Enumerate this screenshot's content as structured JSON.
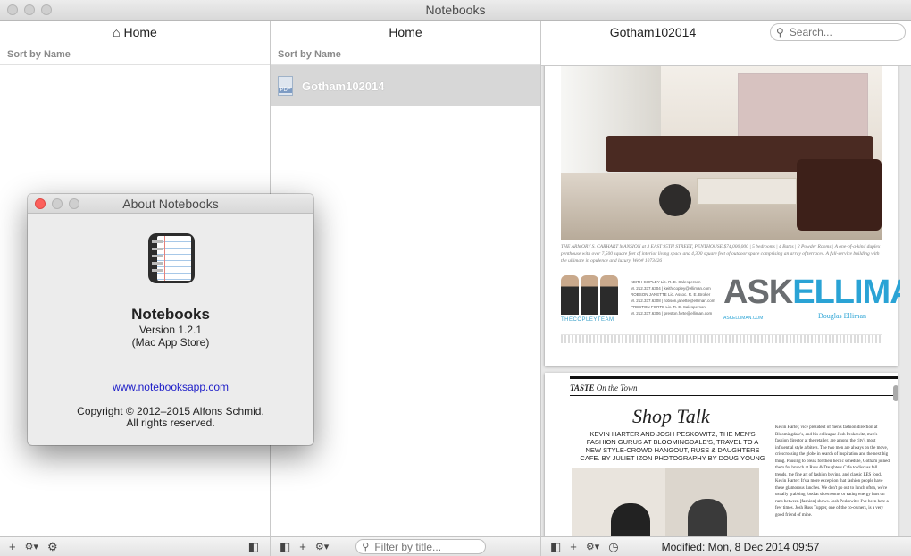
{
  "window": {
    "title": "Notebooks"
  },
  "pane1": {
    "header": "⌂ Home",
    "sort_label": "Sort by Name"
  },
  "pane2": {
    "header": "Home",
    "sort_label": "Sort by Name",
    "items": [
      {
        "name": "Gotham102014",
        "icon": "pdf-icon",
        "icon_text": "PDF"
      }
    ]
  },
  "pane3": {
    "header": "Gotham102014",
    "search": {
      "placeholder": "Search...",
      "icon": "search-icon"
    },
    "document": {
      "page1": {
        "caption": "THE ARMORY S. CARHART MANSION at 3 EAST 95TH STREET, PENTHOUSE  $74,000,000 | 5 bedrooms | 4 Baths | 2 Powder Rooms | A one-of-a-kind duplex penthouse with over 7,500 square feet of interior living space and 4,300 square feet of outdoor space comprising an array of terraces. A full-service building with the ultimate in opulence and luxury. Web# 1073426",
        "team_label": "THECOPLEYTEAM",
        "contacts": [
          "KEITH COPLEY  Lic. R. E. Salesperson",
          "M. 212.337.6304 | keith.copley@elliman.com",
          "ROBSON JANETTE  Lic. Assoc. R. E. Broker",
          "M. 212.337.6308 | robson.janette@elliman.com",
          "PRESTON FORTE  Lic. R. E. Salesperson",
          "M. 212.337.6306 | preston.forte@elliman.com"
        ],
        "brand_ask": "ASK",
        "brand_elliman": "ELLIMAN",
        "brand_site": "ASKELLIMAN.COM",
        "brand_sub": "Douglas Elliman"
      },
      "page2": {
        "section": "TASTE",
        "section_sub": "On the Town",
        "headline": "Shop Talk",
        "deck": "KEVIN HARTER AND JOSH PESKOWITZ, THE MEN'S FASHION GURUS AT BLOOMINGDALE'S, TRAVEL TO A NEW STYLE-CROWD HANGOUT, RUSS & DAUGHTERS CAFE.",
        "byline": "BY JULIET IZON  PHOTOGRAPHY BY DOUG YOUNG",
        "body": "Kevin Harter, vice president of men's fashion direction at Bloomingdale's, and his colleague Josh Peskowitz, men's fashion director at the retailer, are among the city's most influential style arbiters. The two men are always on the move, crisscrossing the globe in search of inspiration and the next big thing. Pausing to break for their hectic schedule, Gotham joined them for brunch at Russ & Daughters Cafe to discuss fall trends, the fine art of fashion buying, and classic LES food.  Kevin Harter: It's a more exception that fashion people have these glamorous lunches. We don't go out to lunch often, we're usually grabbing food at showrooms or eating energy bars on runs between [fashion] shows.  Josh Peskowitz: I've been here a few times. Josh Russ Tupper, one of the co-owners, is a very good friend of mine."
      }
    },
    "modified": "Modified: Mon, 8 Dec 2014 09:57"
  },
  "bottom": {
    "pane1": {
      "add_icon": "+",
      "gear_menu_icon": "⚙▾",
      "settings_icon": "⚙",
      "sidebar_toggle_icon": "◧"
    },
    "pane2": {
      "sidebar_toggle_icon": "◧",
      "add_icon": "+",
      "gear_menu_icon": "⚙▾",
      "filter_placeholder": "Filter by title...",
      "filter_icon": "search-icon"
    },
    "pane3": {
      "sidebar_toggle_icon": "◧",
      "add_icon": "+",
      "gear_menu_icon": "⚙▾",
      "history_icon": "◷"
    }
  },
  "about": {
    "title": "About Notebooks",
    "app_name": "Notebooks",
    "version": "Version 1.2.1",
    "store": "(Mac App Store)",
    "link": "www.notebooksapp.com",
    "copyright": "Copyright © 2012–2015 Alfons Schmid.",
    "rights": "All rights reserved."
  },
  "colors": {
    "selection_gray": "#d7d7d7",
    "close_red": "#fc605c",
    "link_blue": "#1d1dc8",
    "elliman_blue": "#2aa3d5"
  }
}
